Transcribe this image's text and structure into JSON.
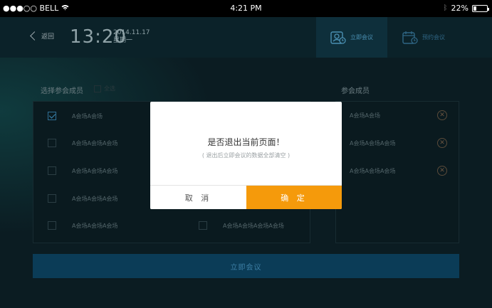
{
  "statusbar": {
    "carrier": "●●●○○ BELL",
    "time": "4:21 PM",
    "battery": "22%",
    "battery_level": 0.22
  },
  "header": {
    "back_label": "返回",
    "clock": "13:20",
    "date": "2014.11.17",
    "weekday": "星期一",
    "tabs": [
      {
        "label": "立即会议"
      },
      {
        "label": "预约会议"
      }
    ]
  },
  "left": {
    "title": "选择参会成员",
    "select_all": "全选",
    "col1": [
      "A会场A会场",
      "A会场A会场A会场",
      "A会场A会场A会场",
      "A会场A会场A会场",
      "A会场A会场A会场"
    ],
    "col2_last": "A会场A会场A会场A会场"
  },
  "right": {
    "title": "参会成员",
    "items": [
      "A会场A会场",
      "A会场A会场A会场",
      "A会场A会场A会场"
    ]
  },
  "bottom_button": "立即会议",
  "modal": {
    "title": "是否退出当前页面！",
    "subtitle": "( 退出后立即会议的数据全部清空 )",
    "cancel": "取 消",
    "confirm": "确 定"
  },
  "colors": {
    "accent": "#f59a0b",
    "bg": "#0a1b22"
  }
}
